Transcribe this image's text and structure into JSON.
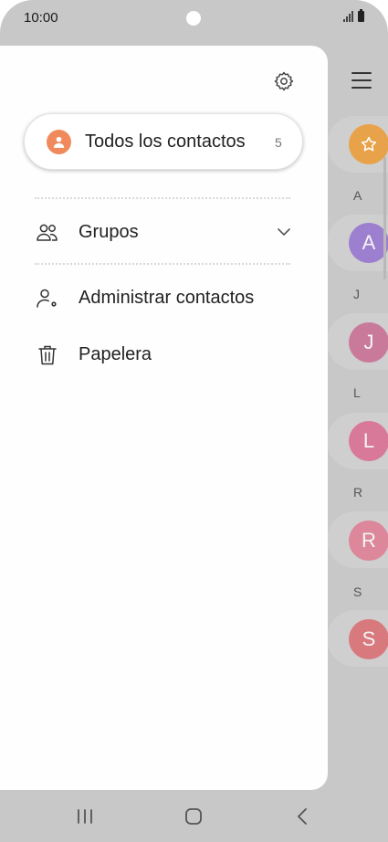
{
  "status_bar": {
    "time": "10:00"
  },
  "drawer": {
    "all_contacts": {
      "label": "Todos los contactos",
      "count": "5"
    },
    "items": [
      {
        "label": "Grupos"
      },
      {
        "label": "Administrar contactos"
      },
      {
        "label": "Papelera"
      }
    ]
  },
  "contact_list": {
    "sections": [
      {
        "header": "A",
        "initial": "A"
      },
      {
        "header": "J",
        "initial": "J"
      },
      {
        "header": "L",
        "initial": "L"
      },
      {
        "header": "R",
        "initial": "R"
      },
      {
        "header": "S",
        "initial": "S"
      }
    ]
  },
  "colors": {
    "accent_orange": "#f08a5d",
    "favorites": "#e8a34a",
    "avatar_a": "#9d7fd0",
    "avatar_j": "#c97a9b",
    "avatar_l": "#d9799a",
    "avatar_r": "#dc879a",
    "avatar_s": "#d8797e"
  },
  "icons": {
    "settings": "gear-icon",
    "groups": "people-icon",
    "manage": "person-gear-icon",
    "trash": "trash-icon",
    "expand": "chevron-down-icon",
    "menu": "hamburger-icon"
  }
}
